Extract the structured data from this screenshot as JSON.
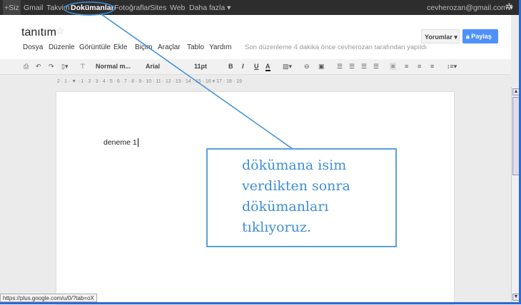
{
  "topbar": {
    "items": [
      "+Siz",
      "Gmail",
      "Takvim",
      "Dokümanlar",
      "Fotoğraflar",
      "Sites",
      "Web",
      "Daha fazla ▾"
    ],
    "account": "cevherozan@gmail.com ▾",
    "settings_icon": "gear-icon"
  },
  "doc": {
    "title": "tanıtım",
    "last_edit": "Son düzenleme 4 dakika önce cevherozan tarafından yapıldı",
    "body_text": "deneme 1"
  },
  "menu": [
    "Dosya",
    "Düzenle",
    "Görüntüle",
    "Ekle",
    "Biçim",
    "Araçlar",
    "Tablo",
    "Yardım"
  ],
  "buttons": {
    "comments": "Yorumlar ▾",
    "share": "Paylaş"
  },
  "toolbar": {
    "style": "Normal m...",
    "font": "Arial",
    "size": "11pt",
    "bold": "B",
    "italic": "I",
    "underline": "U",
    "text_color": "A"
  },
  "ruler": "2 · 1 · ▼ · 1 · 2 · 3 · 4 · 5 · 6 · 7 · 8 · 9 · 10 · 11 · 12 · 13 · 14 · 15 · 16 ▾ 17 · 18 · 19",
  "status_url": "https://plus.google.com/u/0/?tab=oX",
  "annotation": {
    "lines": [
      "dökümana isim",
      "verdikten sonra",
      "dökümanları",
      "tıklıyoruz."
    ],
    "color": "#3d8ed6"
  },
  "colors": {
    "accent": "#4d90fe",
    "topbar": "#2d2d2d"
  }
}
